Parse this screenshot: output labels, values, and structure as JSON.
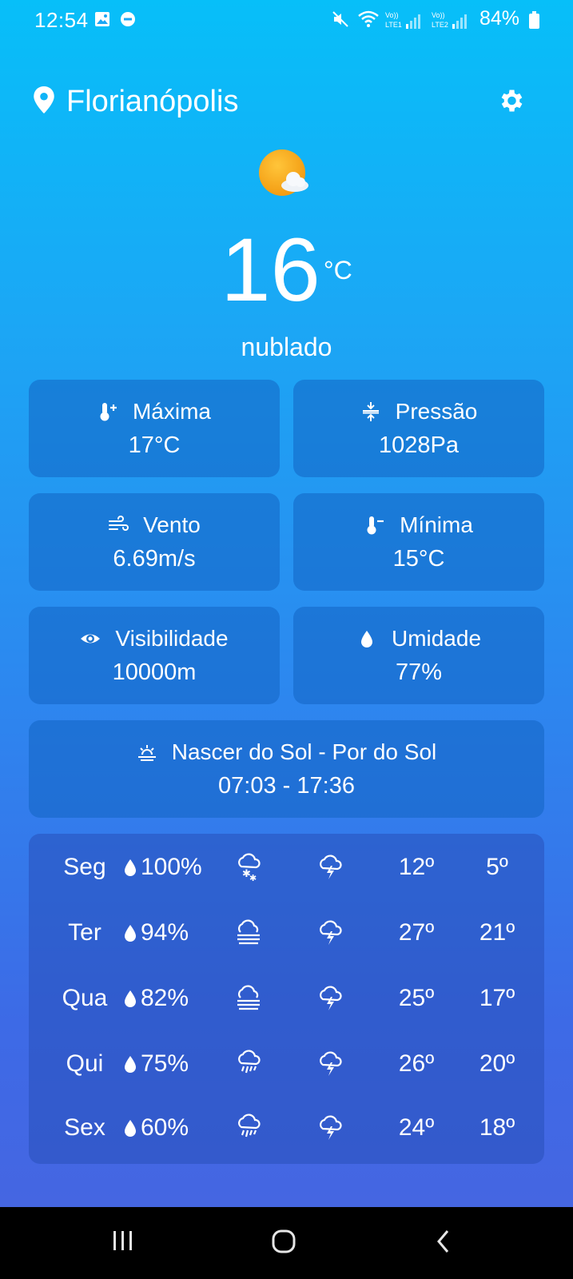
{
  "status_bar": {
    "time": "12:54",
    "battery": "84%"
  },
  "header": {
    "location": "Florianópolis"
  },
  "current": {
    "temperature": "16",
    "unit": "°C",
    "condition": "nublado"
  },
  "cards": {
    "max": {
      "label": "Máxima",
      "value": "17°C",
      "icon": "thermometer-plus-icon"
    },
    "pressure": {
      "label": "Pressão",
      "value": "1028Pa",
      "icon": "pressure-icon"
    },
    "wind": {
      "label": "Vento",
      "value": "6.69m/s",
      "icon": "wind-icon"
    },
    "min": {
      "label": "Mínima",
      "value": "15°C",
      "icon": "thermometer-minus-icon"
    },
    "visibility": {
      "label": "Visibilidade",
      "value": "10000m",
      "icon": "eye-icon"
    },
    "humidity": {
      "label": "Umidade",
      "value": "77%",
      "icon": "droplet-icon"
    },
    "sun": {
      "label": "Nascer do Sol - Por do Sol",
      "value": "07:03 - 17:36",
      "icon": "sunrise-icon"
    }
  },
  "forecast": [
    {
      "day": "Seg",
      "rain": "100%",
      "icon": "snow-cloud-icon",
      "max": "12º",
      "min": "5º"
    },
    {
      "day": "Ter",
      "rain": "94%",
      "icon": "fog-cloud-icon",
      "max": "27º",
      "min": "21º"
    },
    {
      "day": "Qua",
      "rain": "82%",
      "icon": "fog-cloud-icon",
      "max": "25º",
      "min": "17º"
    },
    {
      "day": "Qui",
      "rain": "75%",
      "icon": "rain-cloud-icon",
      "max": "26º",
      "min": "20º"
    },
    {
      "day": "Sex",
      "rain": "60%",
      "icon": "rain-cloud-icon",
      "max": "24º",
      "min": "18º"
    }
  ],
  "colors": {
    "sun": "#f5a623",
    "card_bg": "#1b6ac4"
  }
}
